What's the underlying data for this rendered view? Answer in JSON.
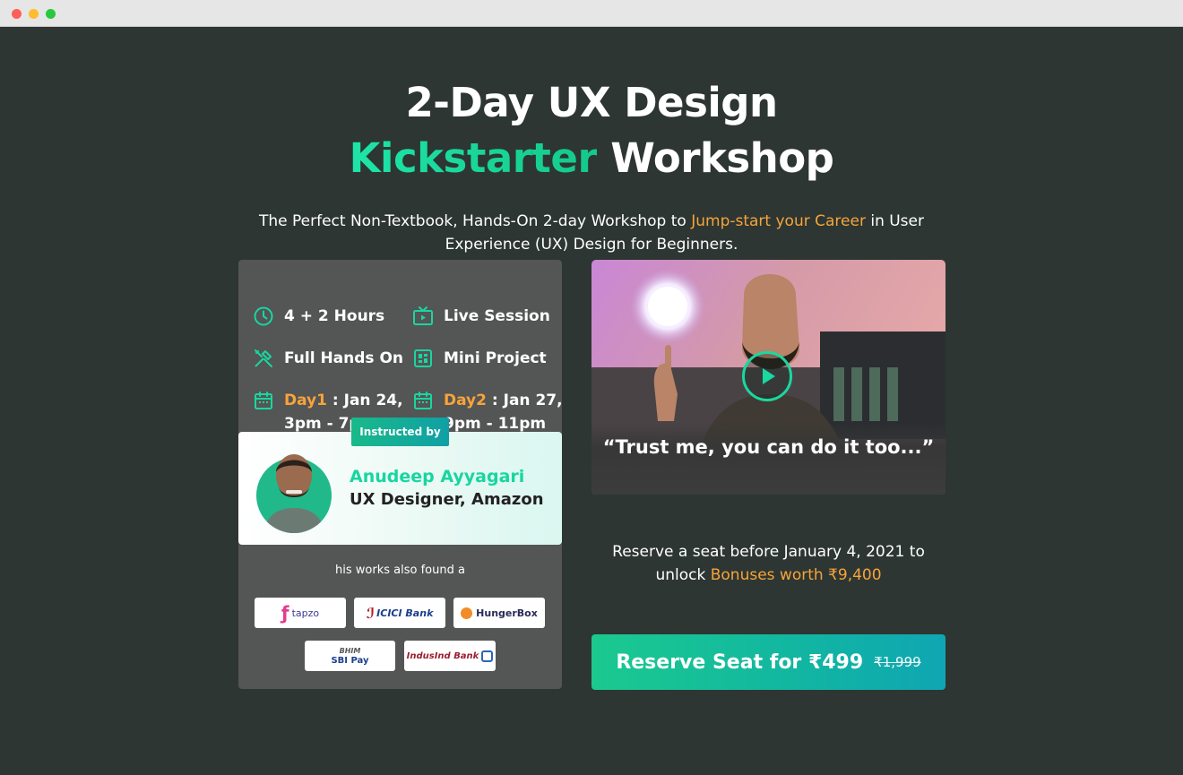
{
  "headline": {
    "line1": "2-Day UX Design",
    "accent": "Kickstarter",
    "line2_rest": " Workshop"
  },
  "subhead": {
    "before": "The Perfect Non-Textbook, Hands-On 2-day Workshop to ",
    "highlight": "Jump-start your Career",
    "after": " in User Experience (UX) Design for Beginners."
  },
  "features": {
    "hours": "4 + 2 Hours",
    "session": "Live Session",
    "hands_on": "Full Hands On",
    "project": "Mini Project",
    "day1_label": "Day1",
    "day1_text": " : Jan 24,",
    "day1_time": "3pm - 7pm",
    "day2_label": "Day2",
    "day2_text": " : Jan 27,",
    "day2_time": "9pm - 11pm"
  },
  "instructor": {
    "badge": "Instructed by",
    "name": "Anudeep Ayyagari",
    "role": "UX Designer, Amazon"
  },
  "works": {
    "label": "his works also found a",
    "logos": [
      "tapzo",
      "ICICI Bank",
      "HungerBox",
      "SBI Pay",
      "IndusInd Bank"
    ],
    "bhim": "BHIM"
  },
  "video": {
    "quote": "“Trust me, you can do it too...”"
  },
  "reserve": {
    "line1": "Reserve a seat before January 4, 2021 to",
    "line2_before": "unlock ",
    "line2_highlight": "Bonuses worth ₹9,400"
  },
  "cta": {
    "label": "Reserve Seat for ₹499",
    "old_price": "₹1,999"
  },
  "colors": {
    "accent_green": "#1ee0a0",
    "accent_orange": "#f7a43a",
    "background": "#2d3632"
  }
}
